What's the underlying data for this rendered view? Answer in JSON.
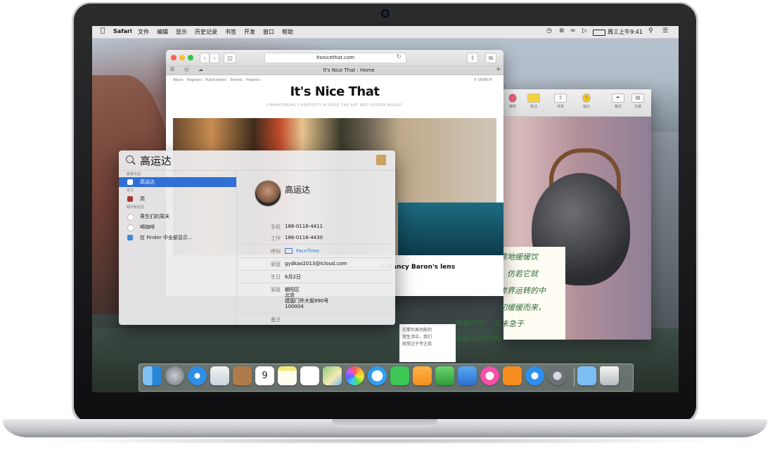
{
  "menubar": {
    "app": "Safari",
    "items": [
      "文件",
      "编辑",
      "显示",
      "历史记录",
      "书签",
      "开发",
      "窗口",
      "帮助"
    ],
    "clock": "周三上午9:41",
    "status_icons": [
      "time-machine-icon",
      "bluetooth-icon",
      "wifi-icon",
      "volume-icon",
      "battery-icon",
      "spotlight-icon",
      "list-icon"
    ]
  },
  "safari": {
    "url": "itsnicethat.com",
    "tab_title": "It's Nice That : Home",
    "nav_links": [
      "About",
      "Regulars",
      "Publications",
      "Events",
      "Projects"
    ],
    "search_label": "SEARCH",
    "site_title": "It's Nice That",
    "tagline": "CHAMPIONING CREATIVITY ACROSS THE ART AND DESIGN WORLD",
    "article_caption": "n Nancy Baron's lens"
  },
  "notes": {
    "toolbar": [
      {
        "icon": "color-icon",
        "label": "媒体"
      },
      {
        "icon": "comment-icon",
        "label": "批注"
      },
      {
        "icon": "share-icon",
        "label": "共享"
      },
      {
        "icon": "hint-icon",
        "label": "提示"
      },
      {
        "icon": "format-icon",
        "label": "格式"
      },
      {
        "icon": "document-icon",
        "label": "文稿"
      }
    ],
    "top_text": "文",
    "poem_lines": [
      "意地缓缓饮",
      "，仿若它就",
      "世界运转的中",
      "切缓缓而来，",
      "静静而去，从未急于",
      "古面运送的的"
    ],
    "bottom_text_1": "在繁忙高功能的",
    "bottom_text_2": "常生活中，我们",
    "bottom_text_3": "经常过于专注我"
  },
  "spotlight": {
    "query": "高运达",
    "sections": [
      "最常点选",
      "定义",
      "邮件和信息"
    ],
    "results": [
      {
        "label": "高运达",
        "icon": "contact-card-icon",
        "selected": true
      },
      {
        "label": "高",
        "icon": "dictionary-icon",
        "selected": false
      },
      {
        "label": "男生们的周末",
        "icon": "message-icon",
        "selected": false
      },
      {
        "label": "喝咖啡",
        "icon": "message-icon",
        "selected": false
      },
      {
        "label": "在 Finder 中全部显示...",
        "icon": "finder-icon",
        "selected": false
      }
    ],
    "contact": {
      "name": "高运达",
      "mobile_label": "手机",
      "mobile": "186-0116-4411",
      "work_label": "工作",
      "work": "186-0116-4430",
      "call_label": "呼叫",
      "call": "FaceTime",
      "email_label": "家庭",
      "email": "gydkao2013@icloud.com",
      "birthday_label": "生日",
      "birthday": "6月2日",
      "address_label": "家庭",
      "address_1": "朝阳区",
      "address_2": "北京",
      "address_3": "建国门外大街890号",
      "address_4": "100004",
      "notes_label": "备注"
    }
  },
  "dock": {
    "apps": [
      "finder-icon",
      "launchpad-icon",
      "safari-icon",
      "mail-icon",
      "contacts-icon",
      "calendar-icon",
      "notes-icon",
      "reminders-icon",
      "maps-icon",
      "photos-icon",
      "messages-icon",
      "facetime-icon",
      "pages-icon",
      "numbers-icon",
      "keynote-icon",
      "itunes-icon",
      "ibooks-icon",
      "app-store-icon",
      "system-preferences-icon",
      "downloads-icon",
      "trash-icon"
    ],
    "calendar_day": "9"
  }
}
